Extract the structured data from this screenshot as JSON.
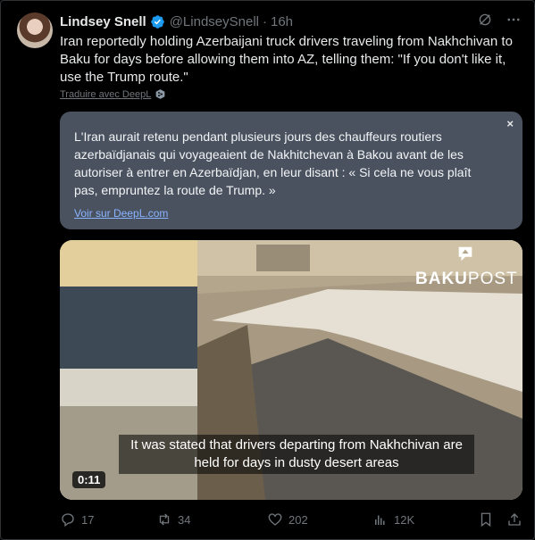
{
  "author": {
    "name": "Lindsey Snell",
    "handle": "@LindseySnell",
    "separator": "·",
    "time": "16h"
  },
  "tweet": {
    "text": "Iran reportedly holding Azerbaijani truck drivers traveling from Nakhchivan to Baku for days before allowing them into AZ, telling them: \"If you don't like it, use the Trump route.\"",
    "translate_label": "Traduire avec DeepL"
  },
  "translation": {
    "text": "L'Iran aurait retenu pendant plusieurs jours des chauffeurs routiers azerbaïdjanais qui voyageaient de Nakhitchevan à Bakou avant de les autoriser à entrer en Azerbaïdjan, en leur disant : « Si cela ne vous plaît pas, empruntez la route de Trump. »",
    "close_label": "×",
    "link_label": "Voir sur DeepL.com"
  },
  "media": {
    "brand_bold": "BAKU",
    "brand_light": "POST",
    "subtitle": "It was stated that drivers departing from Nakhchivan are held for days in dusty desert areas",
    "duration": "0:11"
  },
  "actions": {
    "replies": "17",
    "reposts": "34",
    "likes": "202",
    "views": "12K"
  },
  "icons": [
    "verified-badge-icon",
    "grok-icon",
    "more-icon",
    "deepl-icon",
    "reply-icon",
    "repost-icon",
    "like-icon",
    "views-icon",
    "bookmark-icon",
    "share-icon"
  ],
  "colors": {
    "background": "#000000",
    "text": "#e7e9ea",
    "muted": "#71767b",
    "verified": "#1d9bf0",
    "translation_bg": "#4a5260",
    "link": "#8ab4ff"
  }
}
